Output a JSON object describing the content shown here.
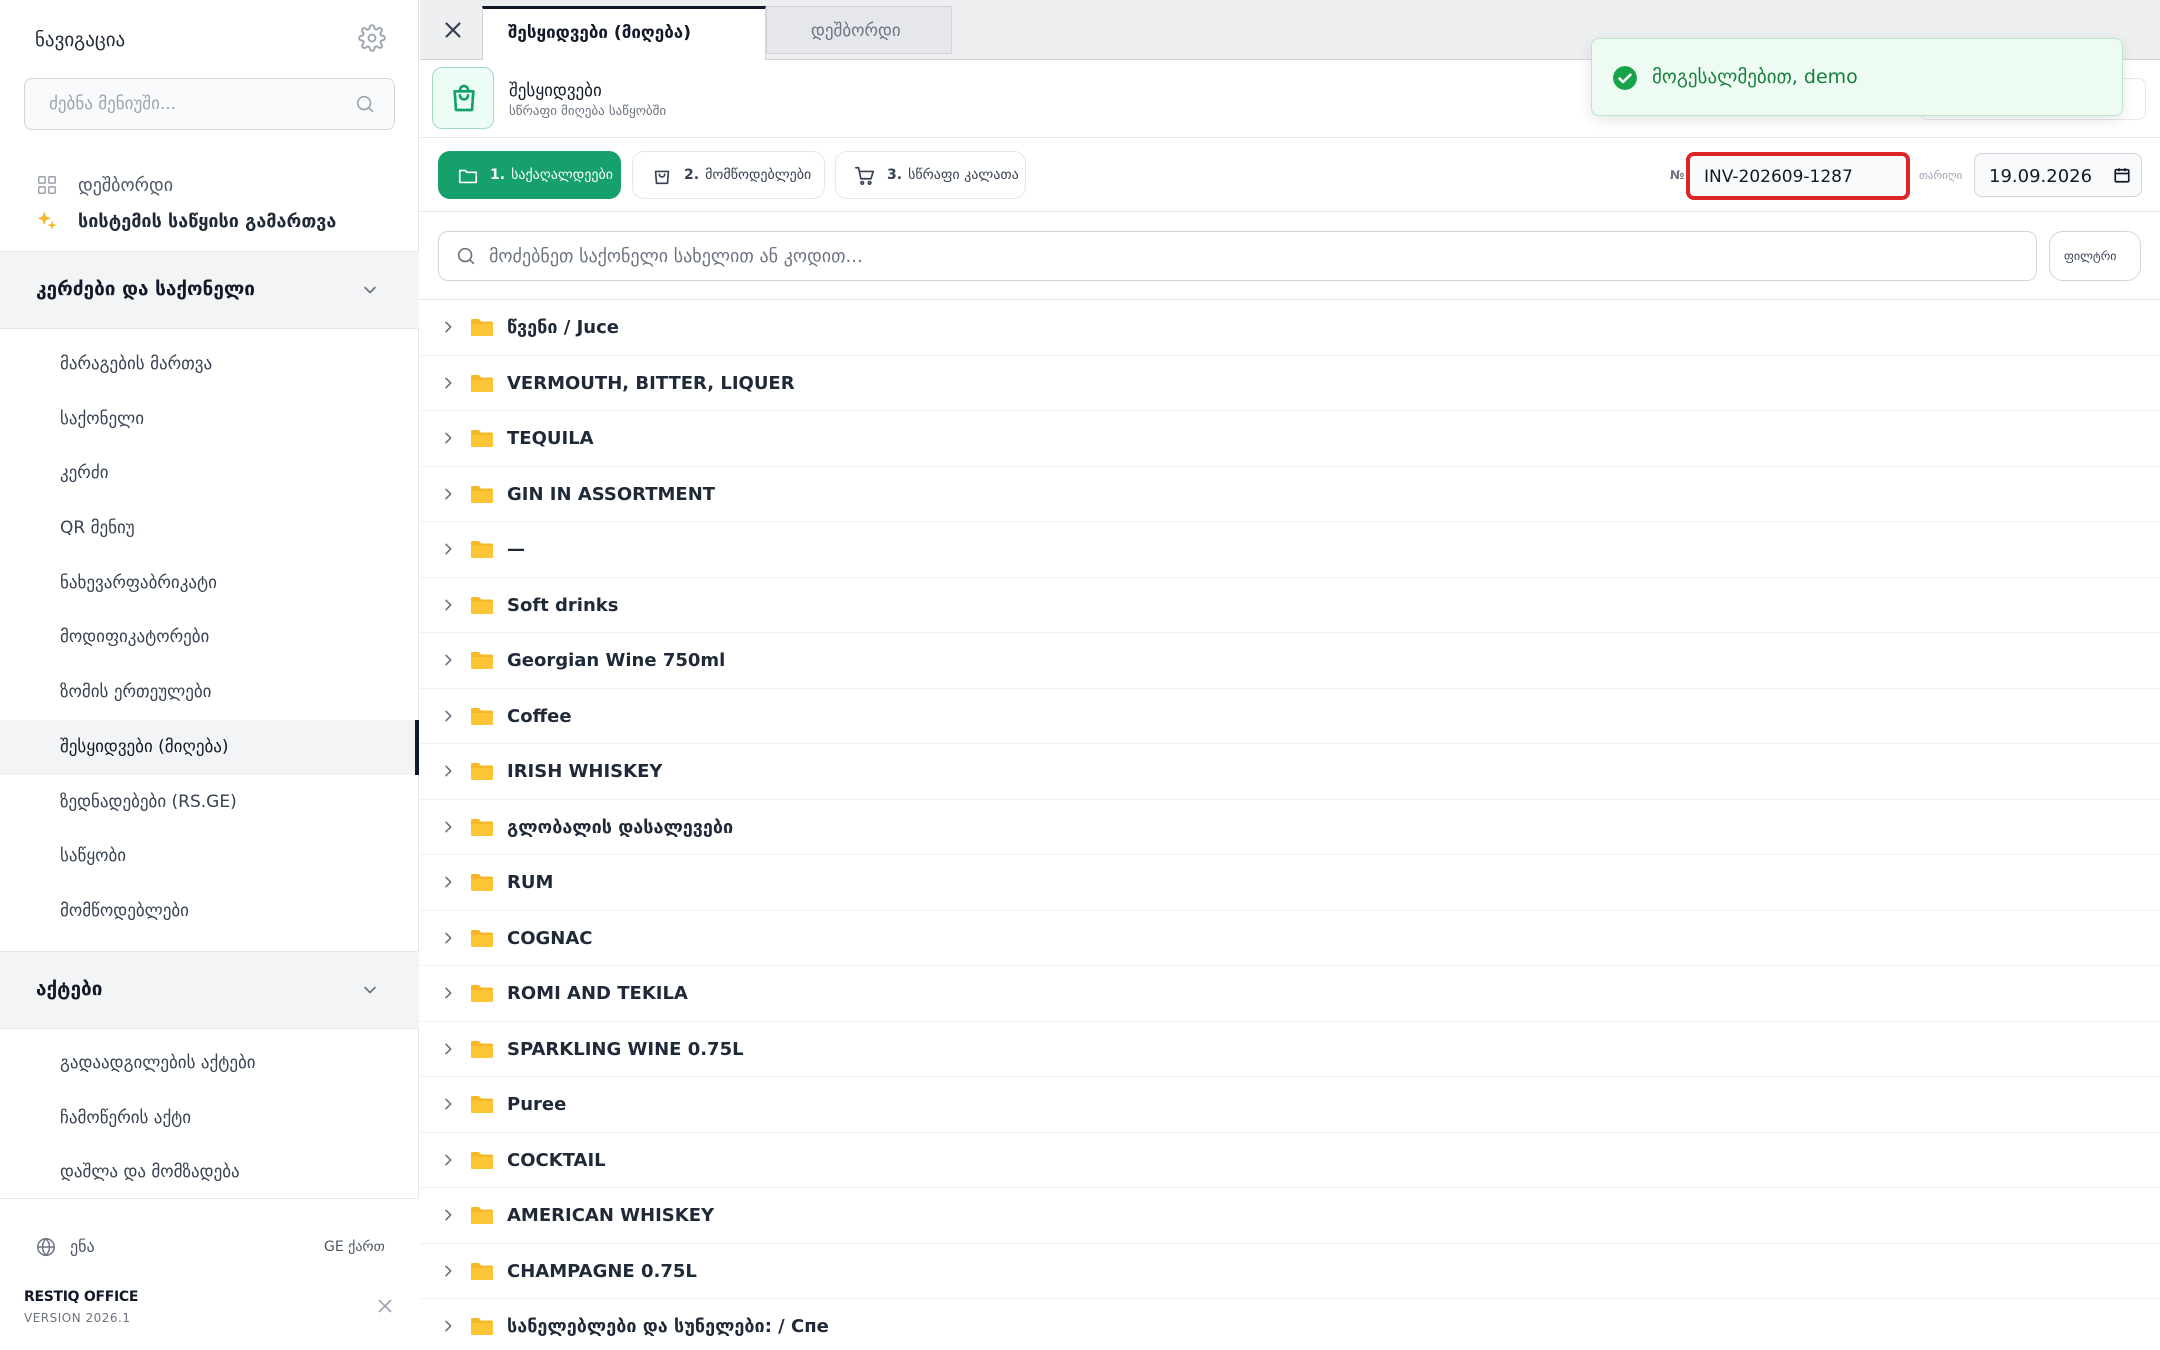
{
  "sidebar": {
    "title": "ნავიგაცია",
    "search_placeholder": "ძებნა მენიუში...",
    "top_items": [
      {
        "label": "დეშბორდი",
        "icon": "grid-icon"
      },
      {
        "label": "სისტემის საწყისი გამართვა",
        "icon": "sparkles-icon"
      }
    ],
    "groups": [
      {
        "label": "კერძები და საქონელი",
        "items": [
          {
            "label": "მარაგების მართვა"
          },
          {
            "label": "საქონელი"
          },
          {
            "label": "კერძი"
          },
          {
            "label": "QR მენიუ"
          },
          {
            "label": "ნახევარფაბრიკატი"
          },
          {
            "label": "მოდიფიკატორები"
          },
          {
            "label": "ზომის ერთეულები"
          },
          {
            "label": "შესყიდვები (მიღება)",
            "active": true
          },
          {
            "label": "ზედნადებები (RS.GE)"
          },
          {
            "label": "საწყობი"
          },
          {
            "label": "მომწოდებლები"
          }
        ]
      },
      {
        "label": "აქტები",
        "items": [
          {
            "label": "გადაადგილების აქტები"
          },
          {
            "label": "ჩამოწერის აქტი"
          },
          {
            "label": "დაშლა და მომზადება"
          }
        ]
      }
    ],
    "footer": {
      "language_label": "ენა",
      "language_value": "GE ქართ",
      "brand": "RESTIQ OFFICE",
      "version": "VERSION 2026.1"
    }
  },
  "tabs": [
    {
      "label": "შესყიდვები (მიღება)",
      "active": true
    },
    {
      "label": "დეშბორდი",
      "active": false
    }
  ],
  "header": {
    "title": "შესყიდვები",
    "subtitle": "სწრაფი მიღება საწყობში"
  },
  "toast": {
    "message": "მოგესალმებით, demo"
  },
  "steps": [
    {
      "num": "1.",
      "label": "საქაღალდეები",
      "icon": "folder-icon",
      "active": true
    },
    {
      "num": "2.",
      "label": "მომწოდებლები",
      "icon": "shopping-bag-icon",
      "active": false
    },
    {
      "num": "3.",
      "label": "სწრაფი კალათა",
      "icon": "cart-icon",
      "active": false
    }
  ],
  "invoice": {
    "no_label": "№",
    "number": "INV-202609-1287",
    "date_label": "თარიღი",
    "date": "19.09.2026"
  },
  "product_search": {
    "placeholder": "მოძებნეთ საქონელი სახელით ან კოდით...",
    "filter_label": "ფილტრი"
  },
  "categories": [
    "წვენი / Juce",
    "VERMOUTH, BITTER, LIQUER",
    "TEQUILA",
    "GIN IN ASSORTMENT",
    "—",
    "Soft drinks",
    "Georgian Wine 750ml",
    "Coffee",
    "IRISH WHISKEY",
    "გლობალის დასალევები",
    "RUM",
    "COGNAC",
    "ROMI AND TEKILA",
    "SPARKLING WINE 0.75L",
    "Puree",
    "COCKTAIL",
    "AMERICAN WHISKEY",
    "CHAMPAGNE 0.75L",
    "სანელებლები და სუნელები: / Спе"
  ],
  "colors": {
    "accent": "#16a06b",
    "folder": "#f5b829",
    "highlight": "#dc2626",
    "toast_text": "#15803d"
  }
}
